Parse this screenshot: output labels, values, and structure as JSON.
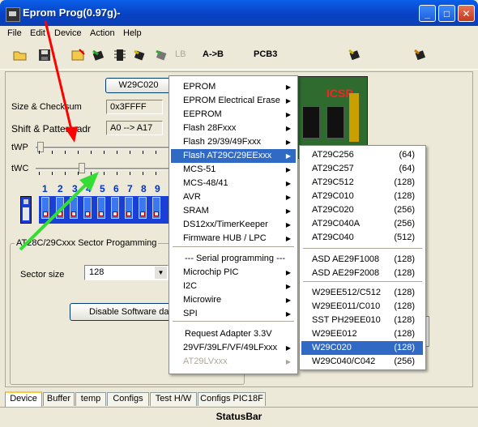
{
  "window": {
    "title": "Eprom Prog(0.97g)-"
  },
  "menubar": [
    "File",
    "Edit",
    "Device",
    "Action",
    "Help"
  ],
  "toolbar": {
    "ab_label": "A->B",
    "pcb_label": "PCB3",
    "lb_label": "LB"
  },
  "device": {
    "chip_name": "W29C020",
    "size_label": "Size & Checksum",
    "size_value": "0x3FFFF",
    "shift_label": "Shift & Pattern adr",
    "shift_value": "A0 --> A17",
    "twp_label": "tWP",
    "twc_label": "tWC"
  },
  "dip_numbers": [
    "1",
    "2",
    "3",
    "4",
    "5",
    "6",
    "7",
    "8",
    "9"
  ],
  "sector": {
    "group_title": "AT28C/29Cxxx Sector Progamming",
    "size_label": "Sector size",
    "size_value": "128",
    "disable_button": "Disable Software da"
  },
  "icsp_label": "ICSP",
  "menu": {
    "items": [
      {
        "label": "EPROM",
        "submenu": true
      },
      {
        "label": "EPROM Electrical Erase",
        "submenu": true
      },
      {
        "label": "EEPROM",
        "submenu": true
      },
      {
        "label": "Flash 28Fxxx",
        "submenu": true
      },
      {
        "label": "Flash 29/39/49Fxxx",
        "submenu": true
      },
      {
        "label": "Flash  AT29C/29EExxx",
        "submenu": true,
        "selected": true
      },
      {
        "label": "MCS-51",
        "submenu": true
      },
      {
        "label": "MCS-48/41",
        "submenu": true
      },
      {
        "label": "AVR",
        "submenu": true
      },
      {
        "label": "SRAM",
        "submenu": true
      },
      {
        "label": "DS12xx/TimerKeeper",
        "submenu": true
      },
      {
        "label": "Firmware HUB / LPC",
        "submenu": true
      },
      {
        "label": "--- Serial programming ---",
        "submenu": false
      },
      {
        "label": "Microchip PIC",
        "submenu": true
      },
      {
        "label": "I2C",
        "submenu": true
      },
      {
        "label": "Microwire",
        "submenu": true
      },
      {
        "label": "SPI",
        "submenu": true
      },
      {
        "label": "Request Adapter 3.3V",
        "submenu": false
      },
      {
        "label": "29VF/39LF/VF/49LFxxx",
        "submenu": true
      },
      {
        "label": "AT29LVxxx",
        "submenu": true,
        "disabled": true
      }
    ]
  },
  "submenu": {
    "items": [
      {
        "name": "AT29C256",
        "size": "(64)"
      },
      {
        "name": "AT29C257",
        "size": "(64)"
      },
      {
        "name": "AT29C512",
        "size": "(128)"
      },
      {
        "name": "AT29C010",
        "size": "(128)"
      },
      {
        "name": "AT29C020",
        "size": "(256)"
      },
      {
        "name": "AT29C040A",
        "size": "(256)"
      },
      {
        "name": "AT29C040",
        "size": "(512)"
      },
      {
        "name": "ASD  AE29F1008",
        "size": "(128)"
      },
      {
        "name": "ASD  AE29F2008",
        "size": "(128)"
      },
      {
        "name": "W29EE512/C512",
        "size": "(128)"
      },
      {
        "name": "W29EE011/C010",
        "size": "(128)"
      },
      {
        "name": "SST PH29EE010",
        "size": "(128)"
      },
      {
        "name": "W29EE012",
        "size": "(128)"
      },
      {
        "name": "W29C020",
        "size": "(128)",
        "selected": true
      },
      {
        "name": "W29C040/C042",
        "size": "(256)"
      }
    ]
  },
  "tabs": [
    "Device",
    "Buffer",
    "temp",
    "Configs",
    "Test H/W",
    "Configs PIC18F"
  ],
  "statusbar": "StatusBar",
  "colors": {
    "titlebar": "#0a5fe8",
    "selection": "#316ac5",
    "arrow_red": "#ff0000",
    "arrow_green": "#33dd33",
    "dip_blue": "#1a3fd6"
  }
}
